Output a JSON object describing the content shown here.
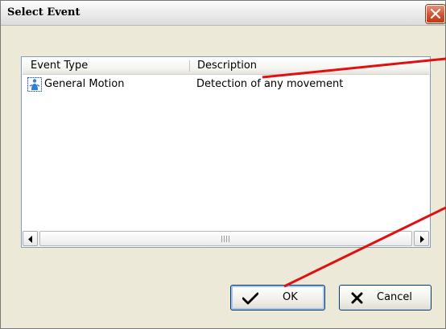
{
  "window": {
    "title": "Select Event"
  },
  "list": {
    "columns": [
      "Event Type",
      "Description"
    ],
    "rows": [
      {
        "event_type": "General Motion",
        "description": "Detection of any movement",
        "icon": "motion-event-icon"
      }
    ]
  },
  "buttons": {
    "ok_label": "OK",
    "cancel_label": "Cancel"
  },
  "colors": {
    "annotation": "#e01010",
    "close_button": "#d2512f",
    "dialog_background": "#ece9d8"
  }
}
